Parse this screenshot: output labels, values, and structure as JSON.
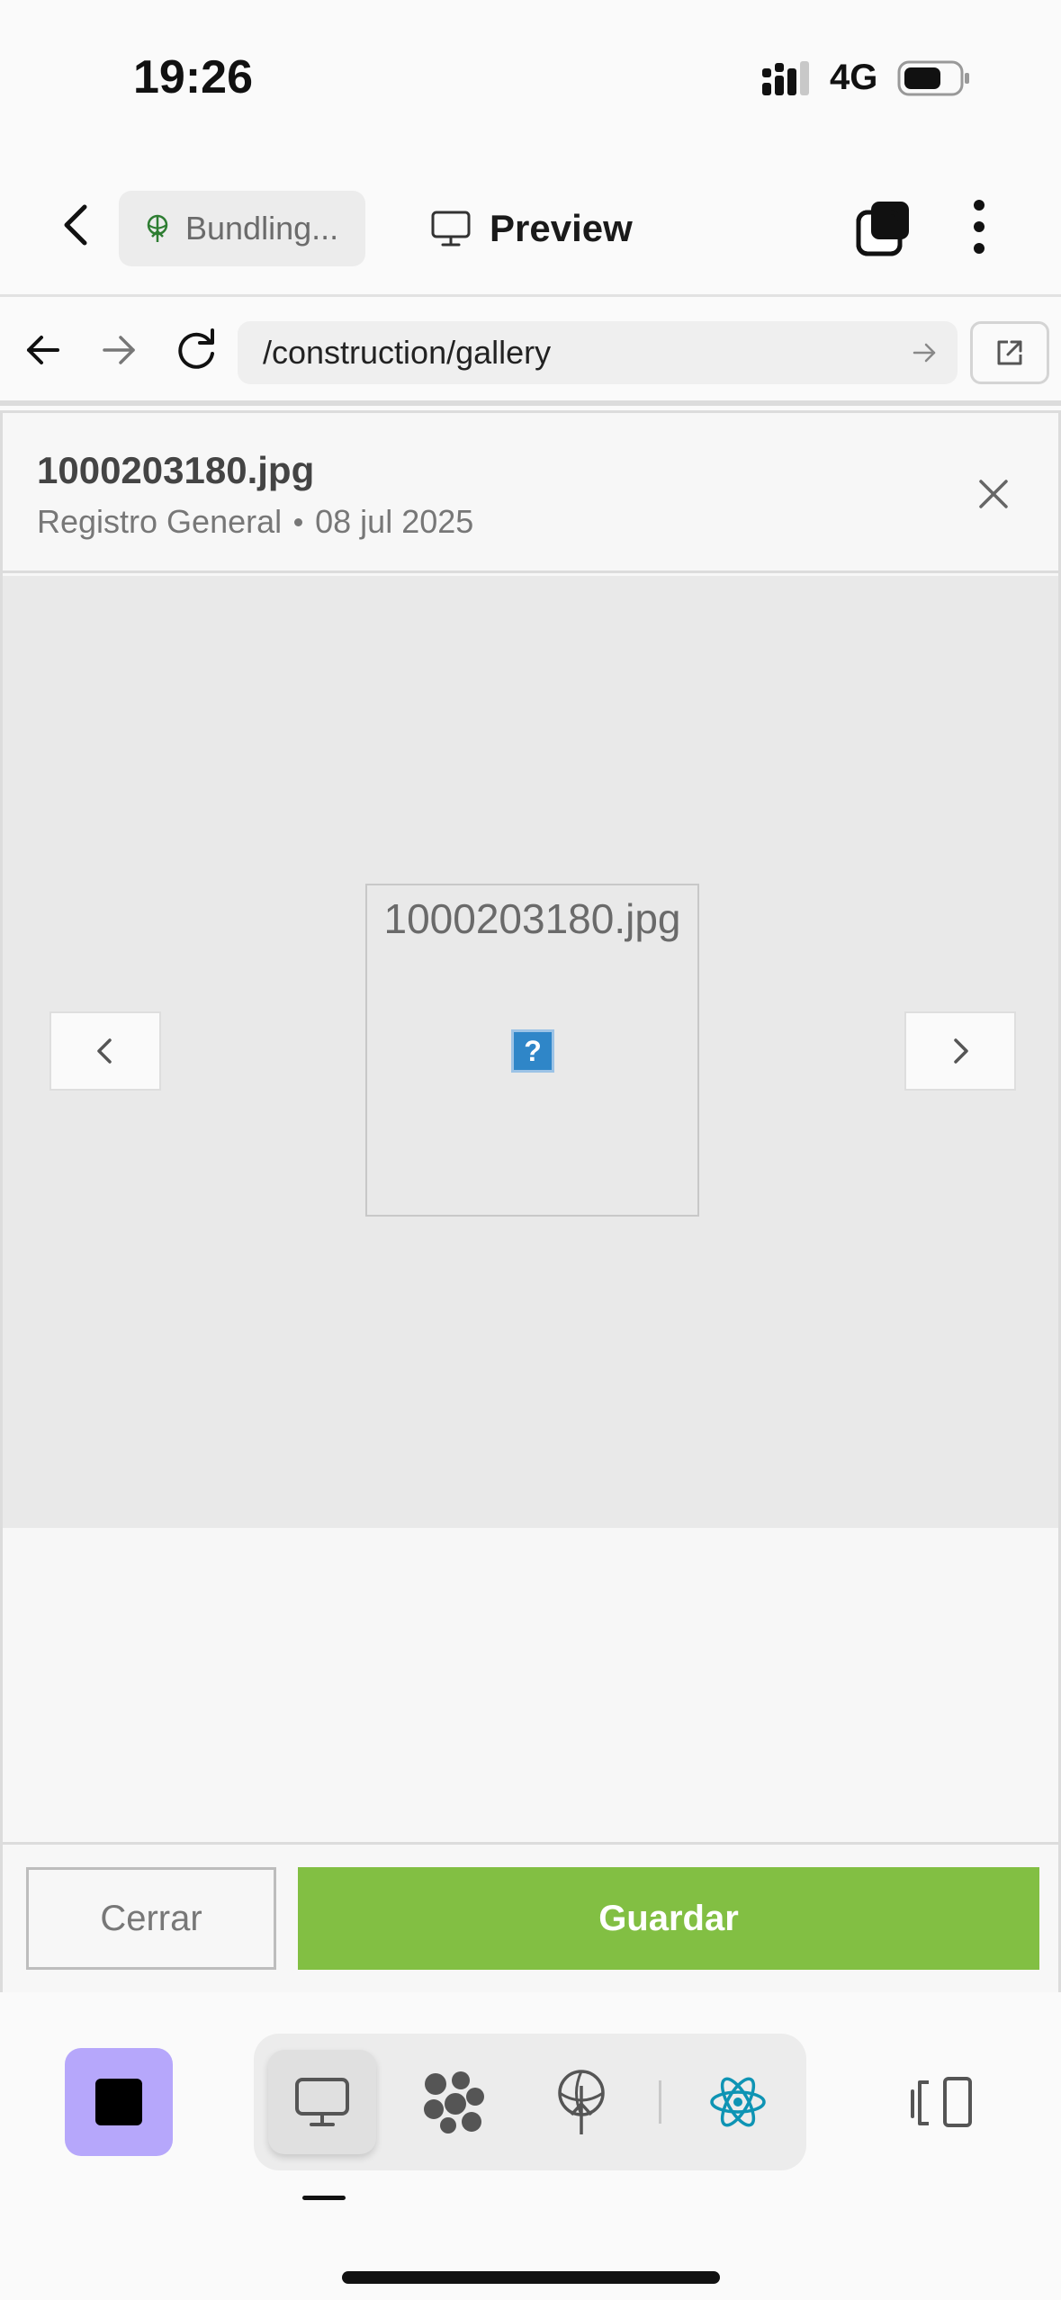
{
  "status_bar": {
    "time": "19:26",
    "network": "4G"
  },
  "app_header": {
    "bundle_label": "Bundling...",
    "preview_label": "Preview"
  },
  "url_bar": {
    "url": "/construction/gallery"
  },
  "modal": {
    "title": "1000203180.jpg",
    "subtitle_left": "Registro General",
    "subtitle_right": "08 jul 2025",
    "image_alt": "1000203180.jpg",
    "broken_image_glyph": "?",
    "cancel_label": "Cerrar",
    "save_label": "Guardar"
  },
  "colors": {
    "save_button": "#82bf43",
    "stop_button": "#b6a7fb",
    "react_icon": "#0e94b4"
  }
}
